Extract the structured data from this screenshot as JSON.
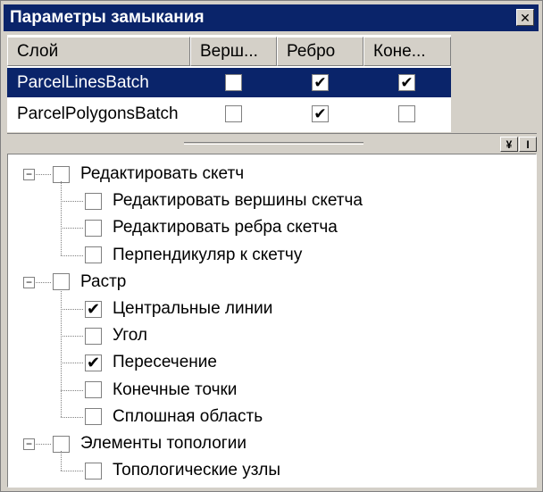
{
  "window": {
    "title": "Параметры замыкания",
    "close_glyph": "✕"
  },
  "grid": {
    "columns": [
      "Слой",
      "Верш...",
      "Ребро",
      "Коне..."
    ],
    "rows": [
      {
        "name": "ParcelLinesBatch",
        "vertex": false,
        "edge": true,
        "end": true,
        "selected": true
      },
      {
        "name": "ParcelPolygonsBatch",
        "vertex": false,
        "edge": true,
        "end": false,
        "selected": false
      }
    ]
  },
  "toolbar": {
    "expand_glyph": "¥",
    "info_glyph": "I"
  },
  "tree": {
    "check_glyph": "✔",
    "collapse_glyph": "−",
    "groups": [
      {
        "label": "Редактировать скетч",
        "checked": false,
        "children": [
          {
            "label": "Редактировать вершины скетча",
            "checked": false
          },
          {
            "label": "Редактировать ребра скетча",
            "checked": false
          },
          {
            "label": "Перпендикуляр к скетчу",
            "checked": false
          }
        ]
      },
      {
        "label": "Растр",
        "checked": false,
        "children": [
          {
            "label": "Центральные линии",
            "checked": true
          },
          {
            "label": "Угол",
            "checked": false
          },
          {
            "label": "Пересечение",
            "checked": true
          },
          {
            "label": "Конечные точки",
            "checked": false
          },
          {
            "label": "Сплошная область",
            "checked": false
          }
        ]
      },
      {
        "label": "Элементы топологии",
        "checked": false,
        "children": [
          {
            "label": "Топологические узлы",
            "checked": false
          }
        ]
      }
    ]
  }
}
